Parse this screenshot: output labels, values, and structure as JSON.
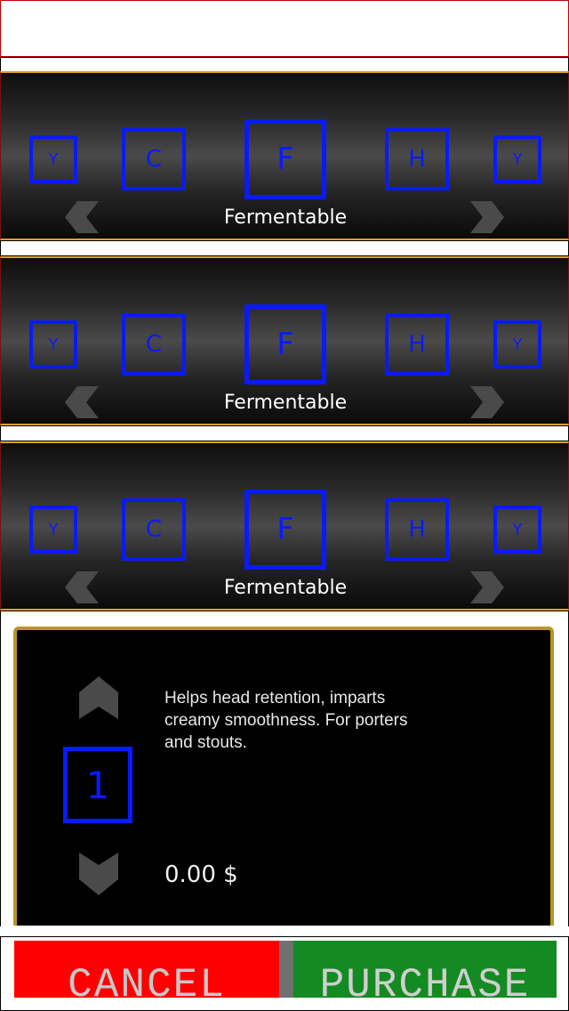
{
  "selectors": [
    {
      "label": "Fermentable",
      "slots": [
        "Y",
        "C",
        "F",
        "H",
        "Y"
      ]
    },
    {
      "label": "Fermentable",
      "slots": [
        "Y",
        "C",
        "F",
        "H",
        "Y"
      ]
    },
    {
      "label": "Fermentable",
      "slots": [
        "Y",
        "C",
        "F",
        "H",
        "Y"
      ]
    }
  ],
  "detail": {
    "quantity": "1",
    "description": "Helps head retention, imparts creamy smoothness. For porters and stouts.",
    "price": "0.00 $"
  },
  "buttons": {
    "cancel": "CANCEL",
    "purchase": "PURCHASE"
  },
  "colors": {
    "slot_border": "#0a1aff",
    "frame_gold": "#b9961d",
    "cancel_bg": "#ff0000",
    "purchase_bg": "#148a22"
  }
}
